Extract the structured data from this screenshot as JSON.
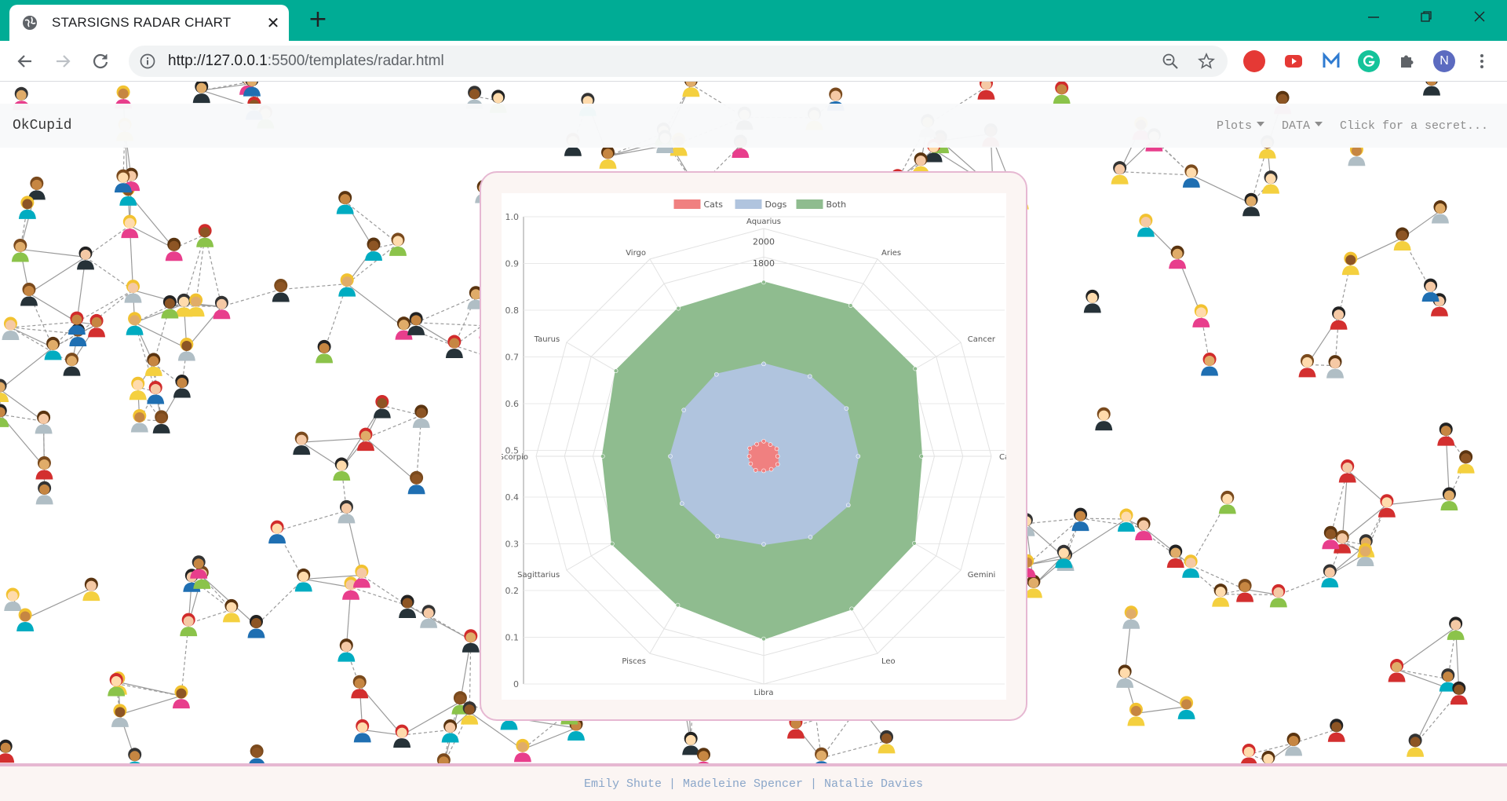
{
  "browser": {
    "tab_title": "STARSIGNS RADAR CHART",
    "url_host": "http://127.0.0.1",
    "url_rest": ":5500/templates/radar.html",
    "profile_initial": "N",
    "accent_color": "#00ac95"
  },
  "navbar": {
    "brand": "OkCupid",
    "links": [
      {
        "label": "Plots",
        "dropdown": true
      },
      {
        "label": "DATA",
        "dropdown": true
      },
      {
        "label": "Click for a secret...",
        "dropdown": false
      }
    ]
  },
  "footer": {
    "credits": "Emily Shute | Madeleine Spencer | Natalie Davies"
  },
  "chart_data": {
    "type": "radar",
    "legend_position": "top",
    "categories": [
      "Aquarius",
      "Aries",
      "Cancer",
      "Capricorn",
      "Gemini",
      "Leo",
      "Libra",
      "Pisces",
      "Sagittarius",
      "Scorpio",
      "Taurus",
      "Virgo"
    ],
    "radial_ticks": [
      "1800",
      "2000"
    ],
    "radial_max": 2120,
    "side_axis_ticks": [
      "0",
      "0.1",
      "0.2",
      "0.3",
      "0.4",
      "0.5",
      "0.6",
      "0.7",
      "0.8",
      "0.9",
      "1.0"
    ],
    "series": [
      {
        "name": "Cats",
        "color": "#f08080",
        "values": [
          140,
          125,
          140,
          130,
          150,
          140,
          135,
          150,
          140,
          135,
          150,
          130
        ]
      },
      {
        "name": "Dogs",
        "color": "#b0c4de",
        "values": [
          860,
          860,
          890,
          880,
          910,
          870,
          820,
          860,
          880,
          870,
          860,
          880
        ]
      },
      {
        "name": "Both",
        "color": "#8fbc8f",
        "values": [
          1620,
          1620,
          1630,
          1470,
          1620,
          1640,
          1700,
          1600,
          1630,
          1500,
          1590,
          1590
        ]
      }
    ],
    "grid": true
  }
}
